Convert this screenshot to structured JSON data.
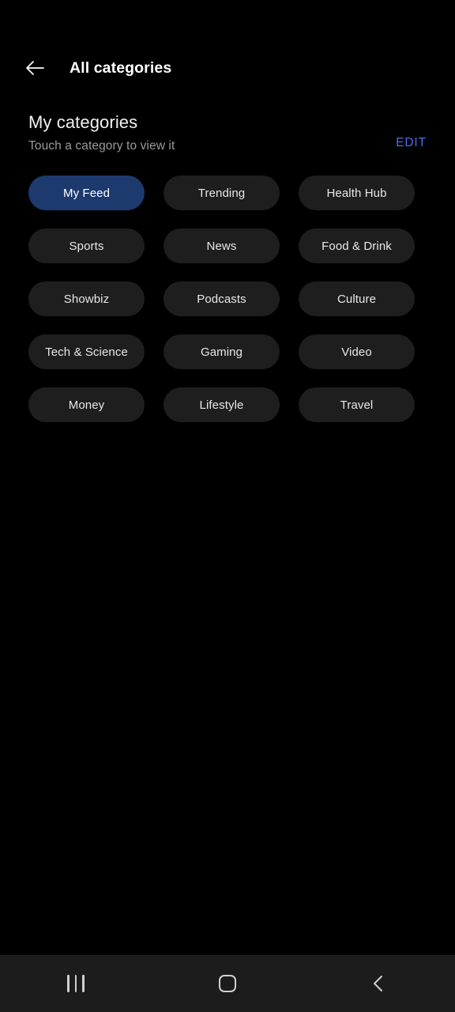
{
  "app_bar": {
    "back_icon": "arrow-left-icon",
    "title": "All categories"
  },
  "section": {
    "title": "My categories",
    "subtitle": "Touch a category to view it",
    "edit_label": "EDIT"
  },
  "categories": [
    {
      "label": "My Feed",
      "selected": true
    },
    {
      "label": "Trending",
      "selected": false
    },
    {
      "label": "Health Hub",
      "selected": false
    },
    {
      "label": "Sports",
      "selected": false
    },
    {
      "label": "News",
      "selected": false
    },
    {
      "label": "Food & Drink",
      "selected": false
    },
    {
      "label": "Showbiz",
      "selected": false
    },
    {
      "label": "Podcasts",
      "selected": false
    },
    {
      "label": "Culture",
      "selected": false
    },
    {
      "label": "Tech & Science",
      "selected": false
    },
    {
      "label": "Gaming",
      "selected": false
    },
    {
      "label": "Video",
      "selected": false
    },
    {
      "label": "Money",
      "selected": false
    },
    {
      "label": "Lifestyle",
      "selected": false
    },
    {
      "label": "Travel",
      "selected": false
    }
  ],
  "nav_bar": {
    "recents_icon": "recents-icon",
    "home_icon": "home-icon",
    "back_icon": "chevron-left-icon"
  },
  "colors": {
    "background": "#000000",
    "chip": "#1e1e1e",
    "chip_selected": "#1c3a6e",
    "accent": "#4a6df0",
    "nav_bar": "#1c1c1c",
    "subtitle": "#9a9a9a"
  }
}
